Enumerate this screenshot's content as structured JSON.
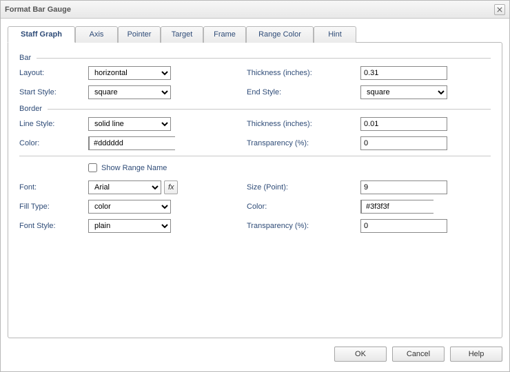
{
  "title": "Format Bar Gauge",
  "tabs": [
    "Staff Graph",
    "Axis",
    "Pointer",
    "Target",
    "Frame",
    "Range Color",
    "Hint"
  ],
  "active_tab": 0,
  "sections": {
    "bar": "Bar",
    "border": "Border"
  },
  "labels": {
    "layout": "Layout:",
    "thickness_in": "Thickness (inches):",
    "start_style": "Start Style:",
    "end_style": "End Style:",
    "line_style": "Line Style:",
    "color": "Color:",
    "transparency": "Transparency (%):",
    "show_range_name": "Show Range Name",
    "font": "Font:",
    "size_point": "Size (Point):",
    "fill_type": "Fill Type:",
    "font_style": "Font Style:"
  },
  "values": {
    "layout": "horizontal",
    "bar_thickness": "0.31",
    "start_style": "square",
    "end_style": "square",
    "line_style": "solid line",
    "border_thickness": "0.01",
    "border_color": "#dddddd",
    "border_transparency": "0",
    "show_range_name": false,
    "font": "Arial",
    "size_point": "9",
    "fill_type": "color",
    "font_color": "#3f3f3f",
    "font_style": "plain",
    "font_transparency": "0"
  },
  "buttons": {
    "ok": "OK",
    "cancel": "Cancel",
    "help": "Help",
    "fx": "fx"
  },
  "select_options": {
    "layout": [
      "horizontal"
    ],
    "start_style": [
      "square"
    ],
    "end_style": [
      "square"
    ],
    "line_style": [
      "solid line"
    ],
    "font": [
      "Arial"
    ],
    "fill_type": [
      "color"
    ],
    "font_style": [
      "plain"
    ]
  }
}
